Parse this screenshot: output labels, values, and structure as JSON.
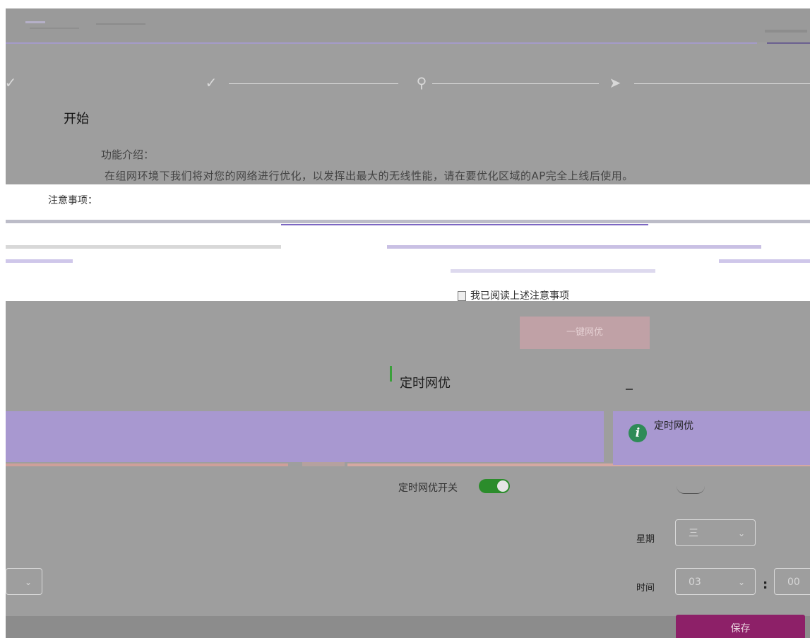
{
  "header": {
    "brand": ""
  },
  "steps": [
    {
      "label": "开始",
      "icon": "check-circle-icon"
    },
    {
      "label": "",
      "icon": "check-circle-icon"
    },
    {
      "label": "",
      "icon": "search-icon"
    },
    {
      "label": "",
      "icon": "rocket-icon"
    }
  ],
  "intro": {
    "title": "功能介绍：",
    "text": "在组网环境下我们将对您的网络进行优化，以发挥出最大的无线性能，请在要优化区域的AP完全上线后使用。"
  },
  "notes": {
    "title": "注意事项："
  },
  "agree": {
    "label": "我已阅读上述注意事项"
  },
  "actions": {
    "one_click": "一键网优"
  },
  "scheduled": {
    "section_title": "定时网优",
    "info_title": "定时网优",
    "toggle_label": "定时网优开关",
    "toggle_on": true,
    "week_label": "星期",
    "week_value": "三",
    "time_label": "时间",
    "hour_value": "03",
    "minute_value": "00",
    "save_label": "保存"
  },
  "colors": {
    "accent": "#8d2068",
    "toggle": "#2b8c2b",
    "info_icon": "#2e8b57"
  }
}
